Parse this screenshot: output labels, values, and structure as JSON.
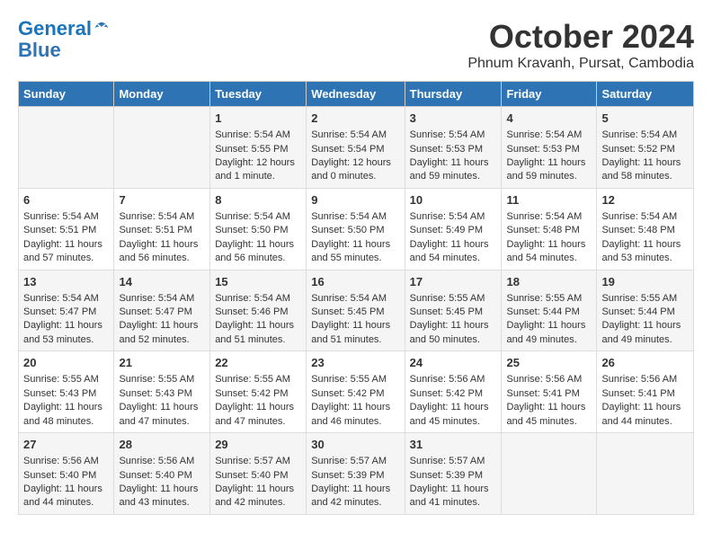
{
  "logo": {
    "line1": "General",
    "line2": "Blue"
  },
  "title": "October 2024",
  "subtitle": "Phnum Kravanh, Pursat, Cambodia",
  "days_of_week": [
    "Sunday",
    "Monday",
    "Tuesday",
    "Wednesday",
    "Thursday",
    "Friday",
    "Saturday"
  ],
  "weeks": [
    [
      {
        "day": "",
        "content": ""
      },
      {
        "day": "",
        "content": ""
      },
      {
        "day": "1",
        "content": "Sunrise: 5:54 AM\nSunset: 5:55 PM\nDaylight: 12 hours\nand 1 minute."
      },
      {
        "day": "2",
        "content": "Sunrise: 5:54 AM\nSunset: 5:54 PM\nDaylight: 12 hours\nand 0 minutes."
      },
      {
        "day": "3",
        "content": "Sunrise: 5:54 AM\nSunset: 5:53 PM\nDaylight: 11 hours\nand 59 minutes."
      },
      {
        "day": "4",
        "content": "Sunrise: 5:54 AM\nSunset: 5:53 PM\nDaylight: 11 hours\nand 59 minutes."
      },
      {
        "day": "5",
        "content": "Sunrise: 5:54 AM\nSunset: 5:52 PM\nDaylight: 11 hours\nand 58 minutes."
      }
    ],
    [
      {
        "day": "6",
        "content": "Sunrise: 5:54 AM\nSunset: 5:51 PM\nDaylight: 11 hours\nand 57 minutes."
      },
      {
        "day": "7",
        "content": "Sunrise: 5:54 AM\nSunset: 5:51 PM\nDaylight: 11 hours\nand 56 minutes."
      },
      {
        "day": "8",
        "content": "Sunrise: 5:54 AM\nSunset: 5:50 PM\nDaylight: 11 hours\nand 56 minutes."
      },
      {
        "day": "9",
        "content": "Sunrise: 5:54 AM\nSunset: 5:50 PM\nDaylight: 11 hours\nand 55 minutes."
      },
      {
        "day": "10",
        "content": "Sunrise: 5:54 AM\nSunset: 5:49 PM\nDaylight: 11 hours\nand 54 minutes."
      },
      {
        "day": "11",
        "content": "Sunrise: 5:54 AM\nSunset: 5:48 PM\nDaylight: 11 hours\nand 54 minutes."
      },
      {
        "day": "12",
        "content": "Sunrise: 5:54 AM\nSunset: 5:48 PM\nDaylight: 11 hours\nand 53 minutes."
      }
    ],
    [
      {
        "day": "13",
        "content": "Sunrise: 5:54 AM\nSunset: 5:47 PM\nDaylight: 11 hours\nand 53 minutes."
      },
      {
        "day": "14",
        "content": "Sunrise: 5:54 AM\nSunset: 5:47 PM\nDaylight: 11 hours\nand 52 minutes."
      },
      {
        "day": "15",
        "content": "Sunrise: 5:54 AM\nSunset: 5:46 PM\nDaylight: 11 hours\nand 51 minutes."
      },
      {
        "day": "16",
        "content": "Sunrise: 5:54 AM\nSunset: 5:45 PM\nDaylight: 11 hours\nand 51 minutes."
      },
      {
        "day": "17",
        "content": "Sunrise: 5:55 AM\nSunset: 5:45 PM\nDaylight: 11 hours\nand 50 minutes."
      },
      {
        "day": "18",
        "content": "Sunrise: 5:55 AM\nSunset: 5:44 PM\nDaylight: 11 hours\nand 49 minutes."
      },
      {
        "day": "19",
        "content": "Sunrise: 5:55 AM\nSunset: 5:44 PM\nDaylight: 11 hours\nand 49 minutes."
      }
    ],
    [
      {
        "day": "20",
        "content": "Sunrise: 5:55 AM\nSunset: 5:43 PM\nDaylight: 11 hours\nand 48 minutes."
      },
      {
        "day": "21",
        "content": "Sunrise: 5:55 AM\nSunset: 5:43 PM\nDaylight: 11 hours\nand 47 minutes."
      },
      {
        "day": "22",
        "content": "Sunrise: 5:55 AM\nSunset: 5:42 PM\nDaylight: 11 hours\nand 47 minutes."
      },
      {
        "day": "23",
        "content": "Sunrise: 5:55 AM\nSunset: 5:42 PM\nDaylight: 11 hours\nand 46 minutes."
      },
      {
        "day": "24",
        "content": "Sunrise: 5:56 AM\nSunset: 5:42 PM\nDaylight: 11 hours\nand 45 minutes."
      },
      {
        "day": "25",
        "content": "Sunrise: 5:56 AM\nSunset: 5:41 PM\nDaylight: 11 hours\nand 45 minutes."
      },
      {
        "day": "26",
        "content": "Sunrise: 5:56 AM\nSunset: 5:41 PM\nDaylight: 11 hours\nand 44 minutes."
      }
    ],
    [
      {
        "day": "27",
        "content": "Sunrise: 5:56 AM\nSunset: 5:40 PM\nDaylight: 11 hours\nand 44 minutes."
      },
      {
        "day": "28",
        "content": "Sunrise: 5:56 AM\nSunset: 5:40 PM\nDaylight: 11 hours\nand 43 minutes."
      },
      {
        "day": "29",
        "content": "Sunrise: 5:57 AM\nSunset: 5:40 PM\nDaylight: 11 hours\nand 42 minutes."
      },
      {
        "day": "30",
        "content": "Sunrise: 5:57 AM\nSunset: 5:39 PM\nDaylight: 11 hours\nand 42 minutes."
      },
      {
        "day": "31",
        "content": "Sunrise: 5:57 AM\nSunset: 5:39 PM\nDaylight: 11 hours\nand 41 minutes."
      },
      {
        "day": "",
        "content": ""
      },
      {
        "day": "",
        "content": ""
      }
    ]
  ]
}
